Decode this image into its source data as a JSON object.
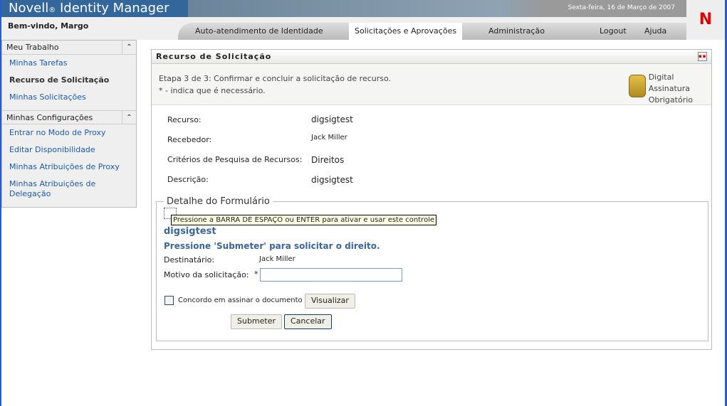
{
  "header": {
    "brand": "Novell",
    "brand_mark": "®",
    "product": "Identity Manager",
    "date": "Sexta-feira, 16 de Março de 2007",
    "logo": "N",
    "welcome": "Bem-vindo, Margo"
  },
  "nav": {
    "tabs": [
      "Auto-atendimento de Identidade",
      "Solicitações e Aprovações",
      "Administração"
    ],
    "logout": "Logout",
    "help": "Ajuda"
  },
  "sidebar": {
    "sections": [
      {
        "title": "Meu Trabalho",
        "items": [
          "Minhas Tarefas",
          "Recurso de Solicitação",
          "Minhas Solicitações"
        ]
      },
      {
        "title": "Minhas Configurações",
        "items": [
          "Entrar no Modo de Proxy",
          "Editar Disponibilidade",
          "Minhas Atribuições de Proxy",
          "Minhas Atribuições de Delegação"
        ]
      }
    ]
  },
  "panel": {
    "title": "Recurso de Solicitação",
    "step": "Etapa 3 de 3: Confirmar e concluir a solicitação de recurso.",
    "required_note": "* - indica que é necessário.",
    "digital_sig": [
      "Digital",
      "Assinatura",
      "Obrigatório"
    ],
    "fields": [
      {
        "label": "Recurso:",
        "value": "digsigtest"
      },
      {
        "label": "Recebedor:",
        "value": "Jack Miller"
      },
      {
        "label": "Critérios de Pesquisa de Recursos:",
        "value": "Direitos"
      },
      {
        "label": "Descrição:",
        "value": "digsigtest"
      }
    ]
  },
  "form": {
    "legend": "Detalhe do Formulário",
    "tooltip": "Pressione a BARRA DE ESPAÇO ou ENTER para ativar e usar este controle",
    "title": "digsigtest",
    "instruction": "Pressione 'Submeter' para solicitar o direito.",
    "recipient_label": "Destinatário:",
    "recipient": "Jack Miller",
    "reason_label": "Motivo da solicitação:",
    "required": "*",
    "reason_value": "",
    "agree_label": "Concordo em assinar o documento",
    "view": "Visualizar",
    "submit": "Submeter",
    "cancel": "Cancelar"
  }
}
